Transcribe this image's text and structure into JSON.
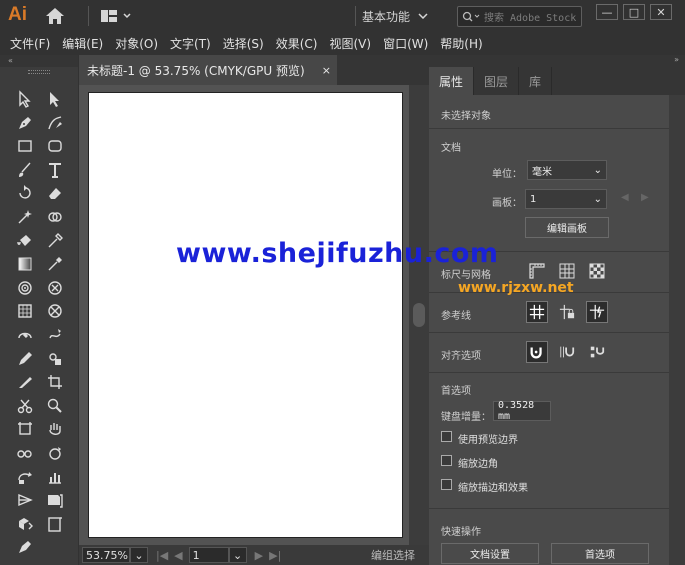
{
  "app": {
    "logo": "Ai",
    "workspace": "基本功能",
    "search_placeholder": "搜索 Adobe Stock"
  },
  "menu": [
    "文件(F)",
    "编辑(E)",
    "对象(O)",
    "文字(T)",
    "选择(S)",
    "效果(C)",
    "视图(V)",
    "窗口(W)",
    "帮助(H)"
  ],
  "document": {
    "tab_title": "未标题-1 @ 53.75% (CMYK/GPU 预览)",
    "close_glyph": "×"
  },
  "status": {
    "zoom": "53.75%",
    "artboard": "1",
    "mode": "编组选择"
  },
  "panel": {
    "tabs": [
      "属性",
      "图层",
      "库"
    ],
    "active_tab": "属性",
    "no_selection": "未选择对象",
    "document_section": "文档",
    "units_label": "单位：",
    "units_value": "毫米",
    "artboard_label": "画板：",
    "artboard_value": "1",
    "edit_artboard_button": "编辑画板",
    "rulers_grids": "标尺与网格",
    "guides": "参考线",
    "snap_options": "对齐选项",
    "preferences": "首选项",
    "keyboard_increment_label": "键盘增量：",
    "keyboard_increment_value": "0.3528 mm",
    "use_preview_bounds": "使用预览边界",
    "scale_corners": "缩放边角",
    "scale_strokes": "缩放描边和效果",
    "quick_actions": "快速操作",
    "doc_setup_button": "文档设置",
    "prefs_button": "首选项"
  },
  "watermark": {
    "line1": "www.shejifuzhu.com",
    "line2": "www.rjzxw.net"
  },
  "colors": {
    "logo": "#d97a28",
    "watermark1": "#1a22d8",
    "watermark2": "#f5a623"
  }
}
